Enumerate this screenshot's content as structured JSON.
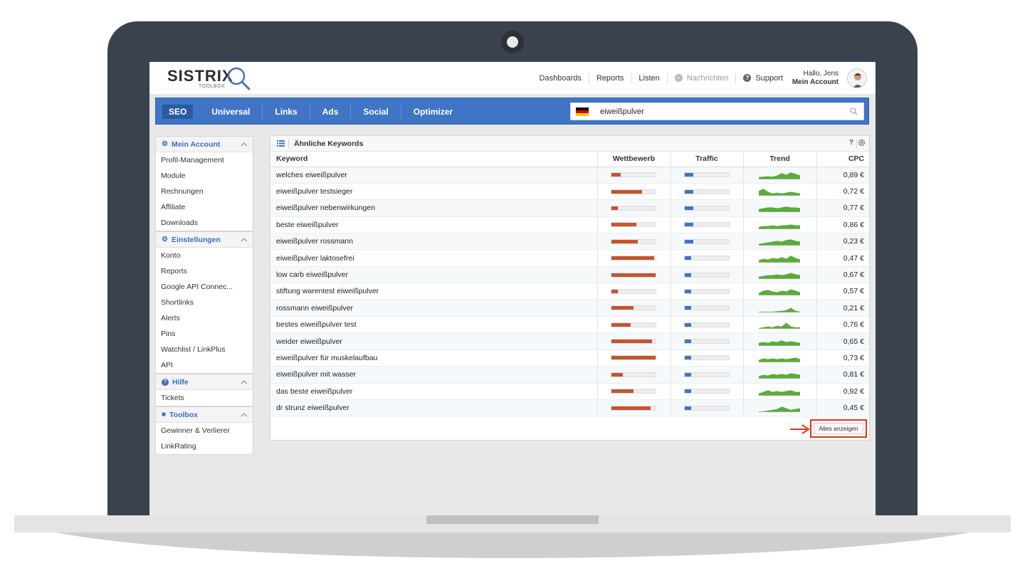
{
  "topbar": {
    "logo_text": "SISTRIX",
    "logo_sub": "TOOLBOX",
    "nav": [
      {
        "label": "Dashboards",
        "icon": ""
      },
      {
        "label": "Reports",
        "icon": ""
      },
      {
        "label": "Listen",
        "icon": ""
      },
      {
        "label": "Nachrichten",
        "icon": "bell-icon",
        "disabled": true
      },
      {
        "label": "Support",
        "icon": "question-icon"
      }
    ],
    "greeting": "Hallo, Jens",
    "account_label": "Mein Account"
  },
  "bluenav": {
    "tabs": [
      "SEO",
      "Universal",
      "Links",
      "Ads",
      "Social",
      "Optimizer"
    ],
    "active_tab": "SEO"
  },
  "search": {
    "value": "eiweißpulver",
    "country_flag": "de-flag-icon"
  },
  "sidebar": {
    "groups": [
      {
        "title": "Mein Account",
        "icon": "gear-icon",
        "items": [
          "Profil-Management",
          "Module",
          "Rechnungen",
          "Affiliate",
          "Downloads"
        ]
      },
      {
        "title": "Einstellungen",
        "icon": "gear-icon",
        "items": [
          "Konto",
          "Reports",
          "Google API Connec...",
          "Shortlinks",
          "Alerts",
          "Pins",
          "Watchlist / LinkPlus",
          "API"
        ]
      },
      {
        "title": "Hilfe",
        "icon": "question-icon",
        "items": [
          "Tickets"
        ]
      },
      {
        "title": "Toolbox",
        "icon": "briefcase-icon",
        "items": [
          "Gewinner & Verlierer",
          "LinkRating"
        ]
      }
    ]
  },
  "panel": {
    "title": "Ähnliche Keywords",
    "help": "?",
    "columns": [
      "Keyword",
      "Wettbewerb",
      "Traffic",
      "Trend",
      "CPC"
    ],
    "rows": [
      {
        "keyword": "welches eiweißpulver",
        "competition": 0.22,
        "traffic": 0.2,
        "cpc": "0,89 €",
        "trend": [
          0.3,
          0.35,
          0.4,
          0.35,
          0.5,
          0.8,
          0.6,
          0.9,
          0.7,
          0.5
        ]
      },
      {
        "keyword": "eiweißpulver testsieger",
        "competition": 0.7,
        "traffic": 0.2,
        "cpc": "0,72 €",
        "trend": [
          0.6,
          0.9,
          0.5,
          0.3,
          0.4,
          0.3,
          0.4,
          0.5,
          0.4,
          0.3
        ]
      },
      {
        "keyword": "eiweißpulver nebenwirkungen",
        "competition": 0.15,
        "traffic": 0.2,
        "cpc": "0,77 €",
        "trend": [
          0.4,
          0.5,
          0.6,
          0.6,
          0.5,
          0.6,
          0.7,
          0.6,
          0.6,
          0.5
        ]
      },
      {
        "keyword": "beste eiweißpulver",
        "competition": 0.57,
        "traffic": 0.2,
        "cpc": "0,86 €",
        "trend": [
          0.3,
          0.4,
          0.4,
          0.5,
          0.4,
          0.5,
          0.5,
          0.6,
          0.5,
          0.5
        ]
      },
      {
        "keyword": "eiweißpulver rossmann",
        "competition": 0.6,
        "traffic": 0.2,
        "cpc": "0,23 €",
        "trend": [
          0.2,
          0.3,
          0.4,
          0.5,
          0.6,
          0.5,
          0.7,
          0.8,
          0.6,
          0.5
        ]
      },
      {
        "keyword": "eiweißpulver laktosefrei",
        "competition": 0.97,
        "traffic": 0.15,
        "cpc": "0,47 €",
        "trend": [
          0.3,
          0.5,
          0.4,
          0.6,
          0.5,
          0.7,
          0.5,
          0.9,
          0.6,
          0.4
        ]
      },
      {
        "keyword": "low carb eiweißpulver",
        "competition": 1.0,
        "traffic": 0.15,
        "cpc": "0,67 €",
        "trend": [
          0.3,
          0.4,
          0.5,
          0.5,
          0.6,
          0.5,
          0.6,
          0.8,
          0.6,
          0.5
        ]
      },
      {
        "keyword": "stiftung warentest eiweißpulver",
        "competition": 0.15,
        "traffic": 0.15,
        "cpc": "0,57 €",
        "trend": [
          0.3,
          0.6,
          0.7,
          0.5,
          0.4,
          0.6,
          0.5,
          0.8,
          0.6,
          0.4
        ]
      },
      {
        "keyword": "rossmann eiweißpulver",
        "competition": 0.5,
        "traffic": 0.15,
        "cpc": "0,21 €",
        "trend": [
          0.1,
          0.1,
          0.1,
          0.1,
          0.15,
          0.2,
          0.3,
          0.6,
          0.2,
          0.1
        ]
      },
      {
        "keyword": "bestes eiweißpulver test",
        "competition": 0.45,
        "traffic": 0.15,
        "cpc": "0,76 €",
        "trend": [
          0.1,
          0.2,
          0.3,
          0.2,
          0.4,
          0.3,
          0.8,
          0.3,
          0.2,
          0.2
        ]
      },
      {
        "keyword": "weider eiweißpulver",
        "competition": 0.93,
        "traffic": 0.15,
        "cpc": "0,65 €",
        "trend": [
          0.4,
          0.5,
          0.4,
          0.6,
          0.5,
          0.7,
          0.5,
          0.6,
          0.5,
          0.4
        ]
      },
      {
        "keyword": "eiweißpulver für muskelaufbau",
        "competition": 1.0,
        "traffic": 0.15,
        "cpc": "0,73 €",
        "trend": [
          0.3,
          0.5,
          0.4,
          0.5,
          0.4,
          0.5,
          0.4,
          0.5,
          0.6,
          0.4
        ]
      },
      {
        "keyword": "eiweißpulver mit wasser",
        "competition": 0.27,
        "traffic": 0.15,
        "cpc": "0,81 €",
        "trend": [
          0.3,
          0.5,
          0.4,
          0.6,
          0.5,
          0.6,
          0.5,
          0.7,
          0.6,
          0.5
        ]
      },
      {
        "keyword": "das beste eiweißpulver",
        "competition": 0.5,
        "traffic": 0.15,
        "cpc": "0,92 €",
        "trend": [
          0.3,
          0.5,
          0.7,
          0.5,
          0.6,
          0.5,
          0.6,
          0.7,
          0.5,
          0.5
        ]
      },
      {
        "keyword": "dr strunz eiweißpulver",
        "competition": 0.9,
        "traffic": 0.15,
        "cpc": "0,45 €",
        "trend": [
          0.1,
          0.1,
          0.2,
          0.3,
          0.4,
          0.7,
          0.5,
          0.3,
          0.4,
          0.5
        ]
      }
    ],
    "show_all": "Alles anzeigen"
  },
  "colors": {
    "brand_blue": "#3f75c4",
    "competition_bar": "#c4552c",
    "trend_green": "#5aac3a",
    "highlight": "#e2321a"
  }
}
